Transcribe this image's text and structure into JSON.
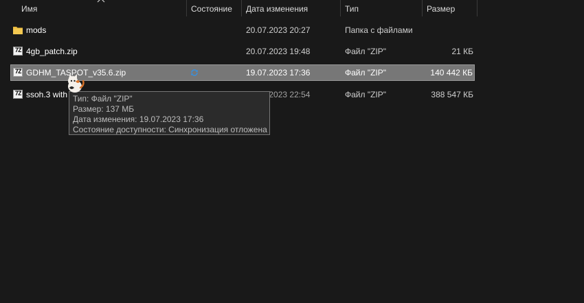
{
  "columns": {
    "name": "Имя",
    "status": "Состояние",
    "modified": "Дата изменения",
    "type": "Тип",
    "size": "Размер"
  },
  "sort_icon": "chevron-up-icon",
  "files": [
    {
      "name": "mods",
      "modified": "20.07.2023 20:27",
      "type": "Папка с файлами",
      "size": "",
      "icon": "folder-icon",
      "sync_pending": false
    },
    {
      "name": "4gb_patch.zip",
      "modified": "20.07.2023 19:48",
      "type": "Файл \"ZIP\"",
      "size": "21 КБ",
      "icon": "zip-icon",
      "sync_pending": false
    },
    {
      "name": "GDHM_TASPOT_v35.6.zip",
      "modified": "19.07.2023 17:36",
      "type": "Файл \"ZIP\"",
      "size": "140 442 КБ",
      "icon": "zip-icon",
      "sync_pending": true,
      "selected": true
    },
    {
      "name": "ssoh.3 with Dippy.zip",
      "modified": "19.07.2023 22:54",
      "type": "Файл \"ZIP\"",
      "size": "388 547 КБ",
      "icon": "zip-icon",
      "sync_pending": true
    }
  ],
  "zip_icon_text": "7Z",
  "tooltip": {
    "line1": "Тип: Файл \"ZIP\"",
    "line2": "Размер: 137 МБ",
    "line3": "Дата изменения: 19.07.2023 17:36",
    "line4": "Состояние доступности: Синхронизация отложена"
  },
  "colors": {
    "background": "#191919",
    "selection": "#777777",
    "folder": "#e8b83c",
    "sync_icon": "#3b8fd9"
  }
}
